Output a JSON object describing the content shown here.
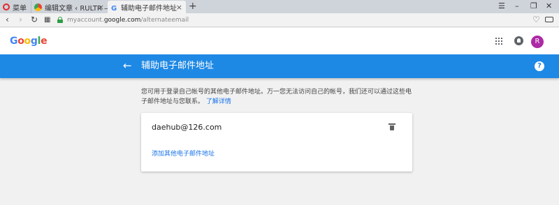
{
  "browser": {
    "tabs": [
      {
        "label": "菜单"
      },
      {
        "label": "编辑文章 ‹ RULTR — Wo"
      },
      {
        "label": "辅助电子邮件地址"
      }
    ],
    "url_prefix": "myaccount.",
    "url_domain": "google.com",
    "url_path": "/alternateemail"
  },
  "header": {
    "logo": "Google",
    "avatar_letter": "R"
  },
  "titlebar": {
    "title": "辅助电子邮件地址"
  },
  "main": {
    "description": "您可用于登录自己帐号的其他电子邮件地址。万一您无法访问自己的帐号，我们还可以通过这些电子邮件地址与您联系。",
    "learn_more": "了解详情",
    "email": "daehub@126.com",
    "add_email_label": "添加其他电子邮件地址"
  },
  "colors": {
    "accent_blue": "#1e88e5",
    "avatar_purple": "#ad2aa5",
    "link_blue": "#1a73e8"
  }
}
